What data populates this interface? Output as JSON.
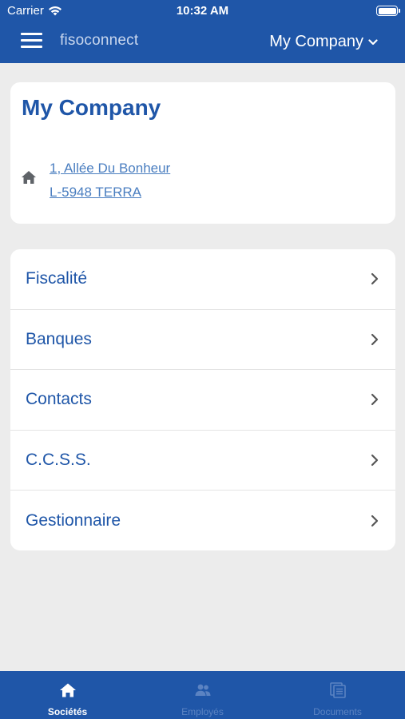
{
  "status_bar": {
    "carrier": "Carrier",
    "time": "10:32 AM"
  },
  "nav": {
    "brand": "fisoconnect",
    "company_selector": "My Company"
  },
  "company": {
    "name": "My Company",
    "address_line1": "1, Allée Du Bonheur",
    "address_line2": "L-5948 TERRA"
  },
  "menu": {
    "items": [
      {
        "label": "Fiscalité"
      },
      {
        "label": "Banques"
      },
      {
        "label": "Contacts"
      },
      {
        "label": "C.C.S.S."
      },
      {
        "label": "Gestionnaire"
      }
    ]
  },
  "tabs": [
    {
      "label": "Sociétés",
      "icon": "home-icon",
      "active": true
    },
    {
      "label": "Employés",
      "icon": "people-icon",
      "active": false
    },
    {
      "label": "Documents",
      "icon": "documents-icon",
      "active": false
    }
  ],
  "colors": {
    "primary": "#1f56a8",
    "background": "#ececec",
    "link": "#4a7ec0",
    "inactive_tab": "#5b83c2"
  }
}
